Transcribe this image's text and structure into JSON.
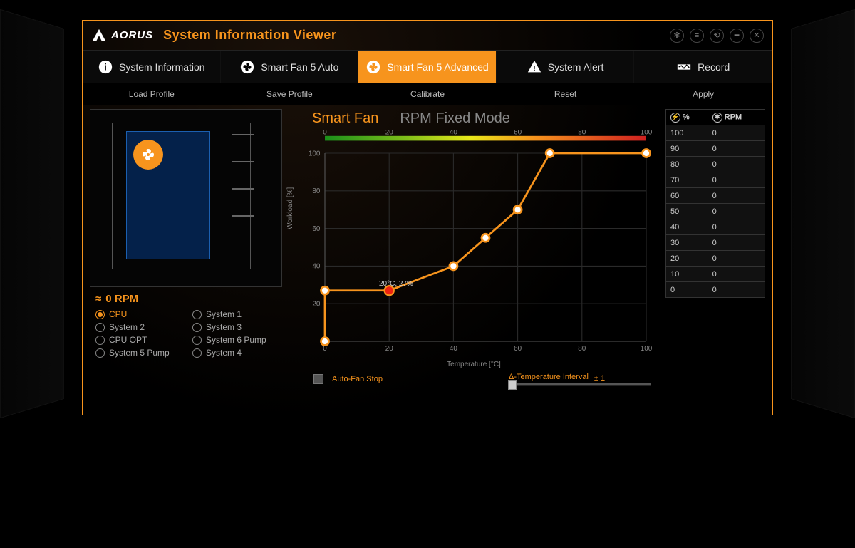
{
  "brand": "AORUS",
  "app_title": "System Information Viewer",
  "tabs": [
    {
      "label": "System Information"
    },
    {
      "label": "Smart Fan 5 Auto"
    },
    {
      "label": "Smart Fan 5 Advanced"
    },
    {
      "label": "System Alert"
    },
    {
      "label": "Record"
    }
  ],
  "active_tab_index": 2,
  "actions": [
    "Load Profile",
    "Save Profile",
    "Calibrate",
    "Reset",
    "Apply"
  ],
  "case": {
    "rpm_label": "0 RPM",
    "fans_col1": [
      "CPU",
      "System 2",
      "CPU OPT",
      "System 5 Pump"
    ],
    "fans_col2": [
      "System 1",
      "System 3",
      "System 6 Pump",
      "System 4"
    ],
    "selected": "CPU"
  },
  "modes": {
    "primary": "Smart Fan",
    "secondary": "RPM Fixed Mode"
  },
  "chart_data": {
    "type": "line",
    "xlabel": "Temperature [°C]",
    "ylabel": "Workload [%]",
    "xlim": [
      0,
      100
    ],
    "ylim": [
      0,
      100
    ],
    "x_ticks": [
      0,
      20,
      40,
      60,
      80,
      100
    ],
    "y_ticks": [
      20,
      40,
      60,
      80,
      100
    ],
    "top_scale_ticks": [
      0,
      20,
      40,
      60,
      80,
      100
    ],
    "points": [
      {
        "x": 0,
        "y": 0
      },
      {
        "x": 0,
        "y": 27
      },
      {
        "x": 20,
        "y": 27
      },
      {
        "x": 40,
        "y": 40
      },
      {
        "x": 50,
        "y": 55
      },
      {
        "x": 60,
        "y": 70
      },
      {
        "x": 70,
        "y": 100
      },
      {
        "x": 100,
        "y": 100
      }
    ],
    "highlight_point": {
      "x": 20,
      "y": 27,
      "label": "20°C, 27%"
    }
  },
  "auto_fan_stop_label": "Auto-Fan Stop",
  "interval": {
    "label": "Δ-Temperature Interval",
    "value": "± 1"
  },
  "table": {
    "col1_header": "%",
    "col2_header": "RPM",
    "rows": [
      {
        "pct": "100",
        "rpm": "0"
      },
      {
        "pct": "90",
        "rpm": "0"
      },
      {
        "pct": "80",
        "rpm": "0"
      },
      {
        "pct": "70",
        "rpm": "0"
      },
      {
        "pct": "60",
        "rpm": "0"
      },
      {
        "pct": "50",
        "rpm": "0"
      },
      {
        "pct": "40",
        "rpm": "0"
      },
      {
        "pct": "30",
        "rpm": "0"
      },
      {
        "pct": "20",
        "rpm": "0"
      },
      {
        "pct": "10",
        "rpm": "0"
      },
      {
        "pct": "0",
        "rpm": "0"
      }
    ]
  }
}
